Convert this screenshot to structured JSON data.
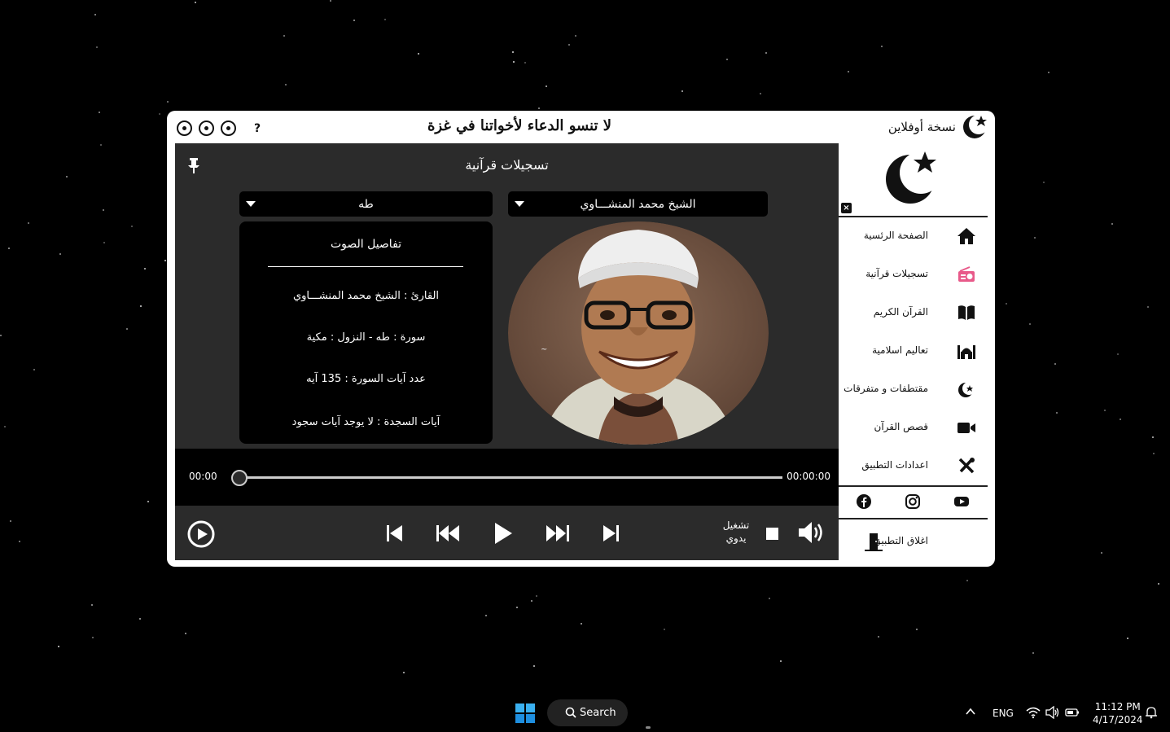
{
  "window": {
    "slogan": "لا تنسو الدعاء لأخواتنا في غزة",
    "offline_label": "نسخة أوفلاين",
    "help": "?"
  },
  "main": {
    "title": "تسجيلات قرآنية",
    "reciter_select": "الشيخ محمد المنشـــاوي",
    "surah_select": "طه",
    "details": {
      "header": "تفاصيل الصوت",
      "reciter_row": "القارئ : الشيخ محمد المنشـــاوي",
      "surah_row": "سورة  :  طه  -  النزول  :  مكية",
      "ayat_row": "عدد آيات السورة :  135  آيه",
      "sajda_row": "آيات السجدة  :  لا يوجد آيات سجود"
    },
    "time_current": "00:00",
    "time_total": "00:00:00",
    "progress": 0,
    "manual_play_line1": "تشغيل",
    "manual_play_line2": "يدوي"
  },
  "sidebar": {
    "items": [
      {
        "label": "الصفحة الرئسية",
        "icon": "home-icon"
      },
      {
        "label": "تسجيلات قرآنية",
        "icon": "radio-icon"
      },
      {
        "label": "القرآن الكريم",
        "icon": "book-icon"
      },
      {
        "label": "تعاليم اسلامية",
        "icon": "mosque-icon"
      },
      {
        "label": "مقتطفات و متفرقات",
        "icon": "crescent-star-icon"
      },
      {
        "label": "قصص القرآن",
        "icon": "video-icon"
      },
      {
        "label": "اعدادات التطبيق",
        "icon": "tools-icon"
      }
    ],
    "exit_label": "اغلاق التطبيق",
    "close_mark": "×"
  },
  "taskbar": {
    "search_label": "Search",
    "language": "ENG",
    "time": "11:12 PM",
    "date": "4/17/2024"
  },
  "colors": {
    "main_bg": "#2b2b2b",
    "panel_bg": "#000000",
    "radio_accent": "#e85a8a"
  }
}
